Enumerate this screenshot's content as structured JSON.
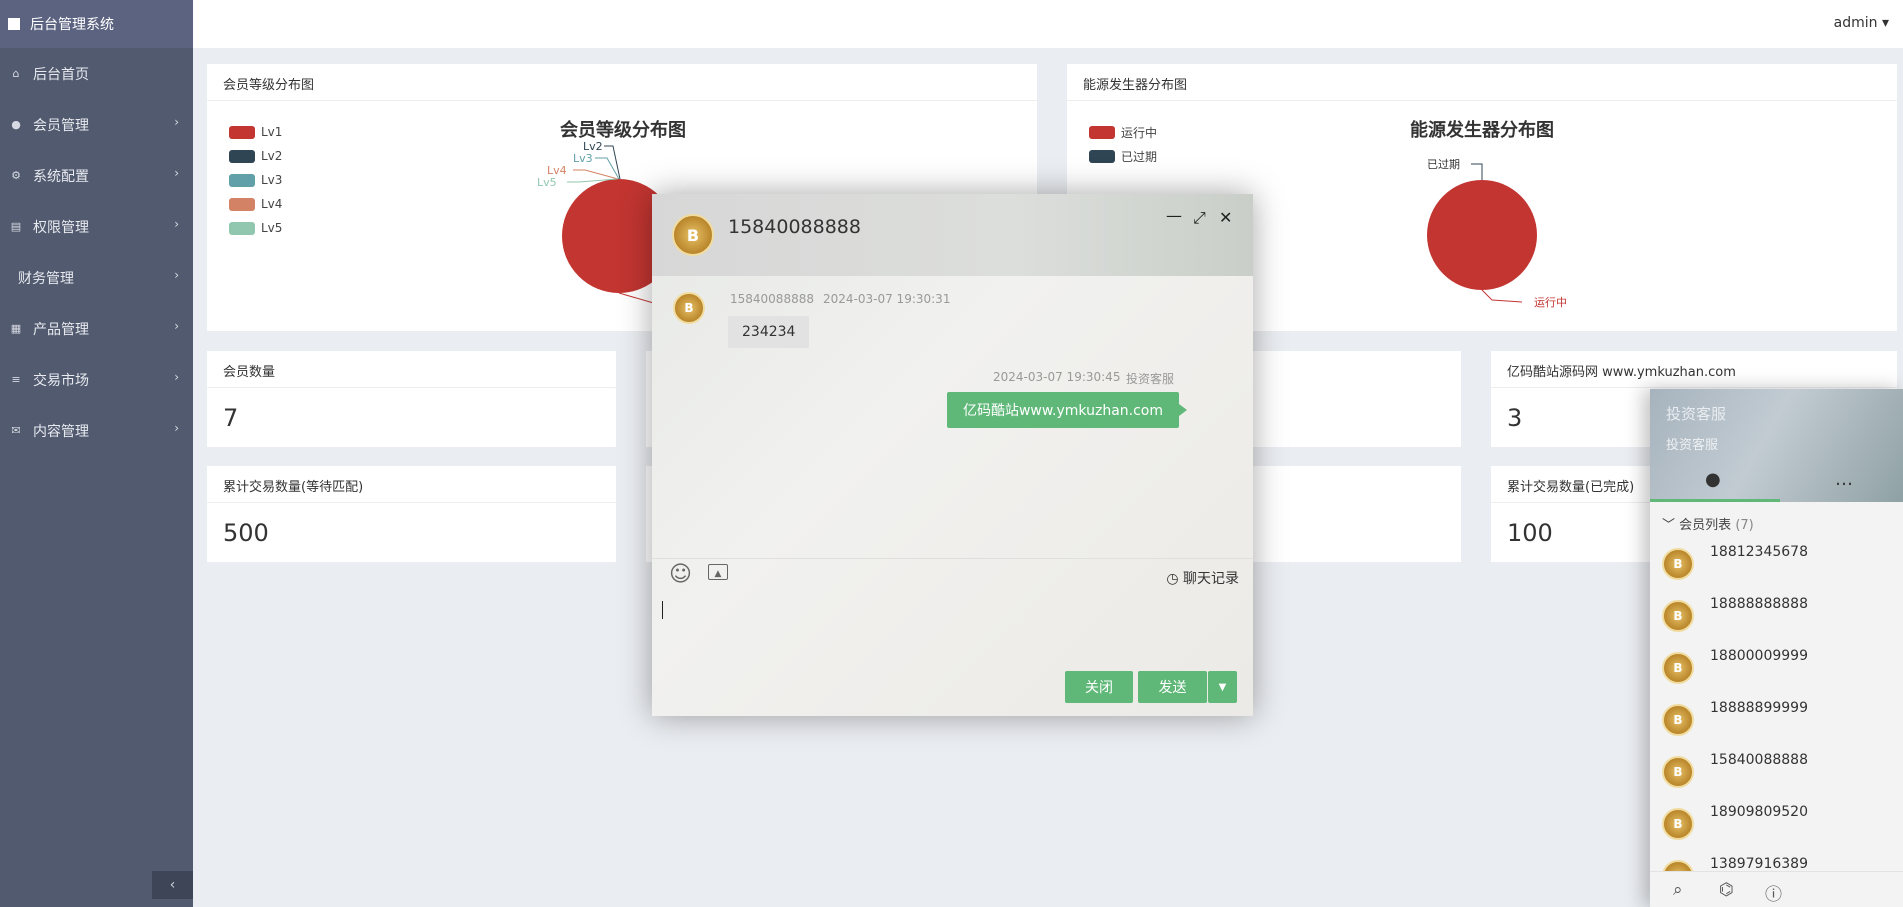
{
  "sidebar": {
    "brand": "后台管理系统",
    "items": [
      {
        "label": "后台首页",
        "icon": "home-icon",
        "glyph": "⌂",
        "arrow": false
      },
      {
        "label": "会员管理",
        "icon": "user-icon",
        "glyph": "●",
        "arrow": true
      },
      {
        "label": "系统配置",
        "icon": "gears-icon",
        "glyph": "⚙",
        "arrow": true
      },
      {
        "label": "权限管理",
        "icon": "list-icon",
        "glyph": "▤",
        "arrow": true
      },
      {
        "label": "财务管理",
        "icon": "",
        "glyph": "",
        "arrow": true
      },
      {
        "label": "产品管理",
        "icon": "grid-icon",
        "glyph": "▦",
        "arrow": true
      },
      {
        "label": "交易市场",
        "icon": "menu-icon",
        "glyph": "≡",
        "arrow": true
      },
      {
        "label": "内容管理",
        "icon": "envelope-icon",
        "glyph": "✉",
        "arrow": true
      }
    ],
    "collapse_glyph": "‹"
  },
  "topbar": {
    "user": "admin ▾"
  },
  "panels": {
    "member_dist": {
      "header": "会员等级分布图",
      "title": "会员等级分布图",
      "legend": [
        {
          "label": "Lv1",
          "color": "#c23531"
        },
        {
          "label": "Lv2",
          "color": "#2f4554"
        },
        {
          "label": "Lv3",
          "color": "#61a0a8"
        },
        {
          "label": "Lv4",
          "color": "#d48265"
        },
        {
          "label": "Lv5",
          "color": "#91c7ae"
        }
      ],
      "labels": [
        "Lv2",
        "Lv3",
        "Lv4",
        "Lv5"
      ]
    },
    "energy_dist": {
      "header": "能源发生器分布图",
      "title": "能源发生器分布图",
      "legend": [
        {
          "label": "运行中",
          "color": "#c23531"
        },
        {
          "label": "已过期",
          "color": "#2f4554"
        }
      ],
      "labels": [
        "已过期",
        "运行中"
      ]
    },
    "stats": [
      {
        "label": "会员数量",
        "value": "7"
      },
      {
        "label": "亿码酷站源码网 www.ymkuzhan.com",
        "value": "3"
      },
      {
        "label": "累计交易数量(等待匹配)",
        "value": "500"
      },
      {
        "label": "累计交易数量(已完成)",
        "value": "100"
      }
    ]
  },
  "chat": {
    "title": "15840088888",
    "controls": {
      "minimize": "—",
      "maximize": "⤢",
      "close": "✕"
    },
    "messages": [
      {
        "sender": "15840088888",
        "time": "2024-03-07 19:30:31",
        "text": "234234"
      },
      {
        "sender": "投资客服",
        "time": "2024-03-07 19:30:45",
        "text": "亿码酷站www.ymkuzhan.com"
      }
    ],
    "history_label": "聊天记录",
    "close_label": "关闭",
    "send_label": "发送"
  },
  "member_panel": {
    "title": "投资客服",
    "subtitle": "投资客服",
    "group_label": "会员列表",
    "group_count": "(7)",
    "members": [
      "18812345678",
      "18888888888",
      "18800009999",
      "18888899999",
      "15840088888",
      "18909809520",
      "13897916389"
    ]
  }
}
